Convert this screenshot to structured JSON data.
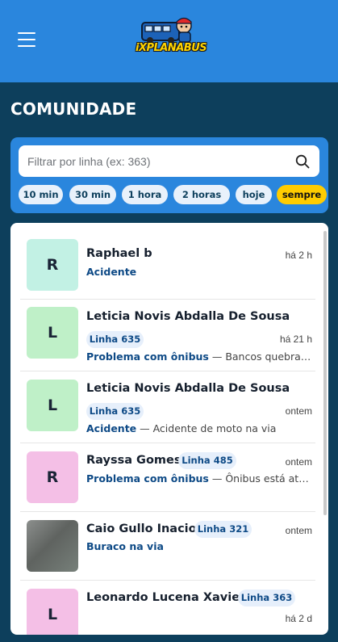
{
  "header": {
    "menu_icon": "hamburger-menu-icon",
    "logo_text": "iXPLANABUS",
    "accent": "#2a86dd"
  },
  "page": {
    "title": "COMUNIDADE",
    "background": "#0d3f5c"
  },
  "search": {
    "value": "",
    "placeholder": "Filtrar por linha (ex: 363)",
    "icon": "search-icon"
  },
  "time_filters": {
    "options": [
      "10 min",
      "30 min",
      "1 hora",
      "2 horas",
      "hoje",
      "sempre"
    ],
    "selected": "sempre",
    "selected_color": "#ffcc00"
  },
  "posts": [
    {
      "avatar": "R",
      "avatar_color": "#c2f1e4",
      "name": "Raphael b",
      "line": "",
      "time": "há 2 h",
      "category": "Acidente",
      "description": ""
    },
    {
      "avatar": "L",
      "avatar_color": "#bff0c8",
      "name": "Leticia Novis Abdalla De Sousa",
      "line": "Linha 635",
      "time": "há 21 h",
      "category": "Problema com ônibus",
      "description": " — Bancos quebrados"
    },
    {
      "avatar": "L",
      "avatar_color": "#bff0c8",
      "name": "Leticia Novis Abdalla De Sousa",
      "line": "Linha 635",
      "time": "ontem",
      "category": "Acidente",
      "description": " — Acidente de moto na via"
    },
    {
      "avatar": "R",
      "avatar_color": "#f4bfe6",
      "name": "Rayssa Gomes",
      "line": "Linha 485",
      "time": "ontem",
      "category": "Problema com ônibus",
      "description": " — Ônibus está atrasad..."
    },
    {
      "avatar": "",
      "avatar_color": "#7d827e",
      "name": "Caio Gullo Inacio",
      "line": "Linha 321",
      "time": "ontem",
      "category": "Buraco na via",
      "description": ""
    },
    {
      "avatar": "L",
      "avatar_color": "#f4bfe6",
      "name": "Leonardo Lucena Xavier",
      "line": "Linha 363",
      "time": "há 2 d",
      "category": "",
      "description": ""
    }
  ]
}
